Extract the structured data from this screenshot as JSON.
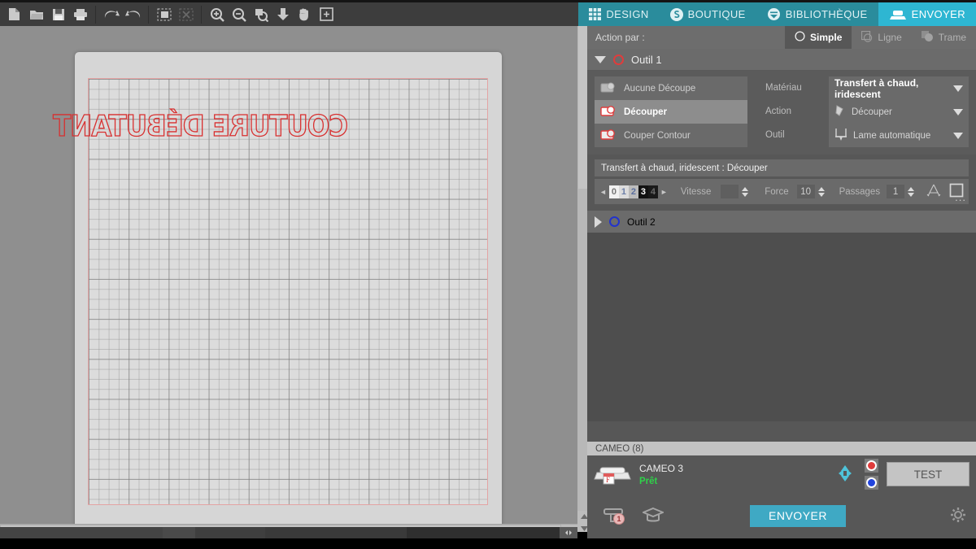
{
  "toolbar": {
    "buttons": [
      {
        "name": "new-file-icon",
        "label": "Nouveau"
      },
      {
        "name": "open-file-icon",
        "label": "Ouvrir"
      },
      {
        "name": "save-file-icon",
        "label": "Enregistrer"
      },
      {
        "name": "print-icon",
        "label": "Imprimer"
      },
      {
        "name": "undo-icon",
        "label": "Annuler"
      },
      {
        "name": "redo-icon",
        "label": "Rétablir"
      },
      {
        "name": "select-all-icon",
        "label": "Tout sélectionner"
      },
      {
        "name": "deselect-icon",
        "label": "Désélectionner"
      },
      {
        "name": "zoom-in-icon",
        "label": "Zoom avant"
      },
      {
        "name": "zoom-out-icon",
        "label": "Zoom arrière"
      },
      {
        "name": "zoom-selection-icon",
        "label": "Zoom sélection"
      },
      {
        "name": "fit-page-icon",
        "label": "Ajuster la page"
      },
      {
        "name": "pan-hand-icon",
        "label": "Main"
      },
      {
        "name": "fit-window-icon",
        "label": "Ajuster la fenêtre"
      }
    ]
  },
  "tabs": [
    {
      "label": "DESIGN",
      "icon": "grid-icon",
      "active": false
    },
    {
      "label": "BOUTIQUE",
      "icon": "store-icon",
      "active": false
    },
    {
      "label": "BIBLIOTHÈQUE",
      "icon": "cloud-library-icon",
      "active": false
    },
    {
      "label": "ENVOYER",
      "icon": "cutter-icon",
      "active": true
    }
  ],
  "canvas": {
    "design_text": "COUTURE DÉBUTANT",
    "design_color": "#d83030",
    "mat_border_color": "#e4a4a4"
  },
  "action_bar": {
    "label": "Action par :",
    "modes": [
      {
        "label": "Simple",
        "icon": "circle-icon",
        "active": true
      },
      {
        "label": "Ligne",
        "icon": "line-layers-icon",
        "active": false
      },
      {
        "label": "Trame",
        "icon": "fill-layers-icon",
        "active": false
      }
    ]
  },
  "tool1": {
    "title": "Outil 1",
    "expanded": true,
    "ring_color": "#e03c3c",
    "actions": [
      {
        "label": "Aucune Découpe",
        "selected": false
      },
      {
        "label": "Découper",
        "selected": true
      },
      {
        "label": "Couper Contour",
        "selected": false
      }
    ],
    "field_labels": [
      "Matériau",
      "Action",
      "Outil"
    ],
    "material": "Transfert à chaud, iridescent",
    "action": "Découper",
    "tool": "Lame automatique",
    "settings_title": "Transfert à chaud, iridescent : Découper",
    "blade_ticks": [
      "0",
      "1",
      "2",
      "3",
      "4"
    ],
    "blade_selected": "3",
    "speed_label": "Vitesse",
    "speed_value": "",
    "force_label": "Force",
    "force_value": "10",
    "passes_label": "Passages",
    "passes_value": "1",
    "more_label": "..."
  },
  "tool2": {
    "title": "Outil 2",
    "expanded": false,
    "ring_color": "#2233cc"
  },
  "device": {
    "group_label": "CAMEO (8)",
    "name": "CAMEO 3",
    "status": "Prêt",
    "status_color": "#2fd14a",
    "test_label": "TEST",
    "send_label": "ENVOYER",
    "queue_badge": "1"
  }
}
